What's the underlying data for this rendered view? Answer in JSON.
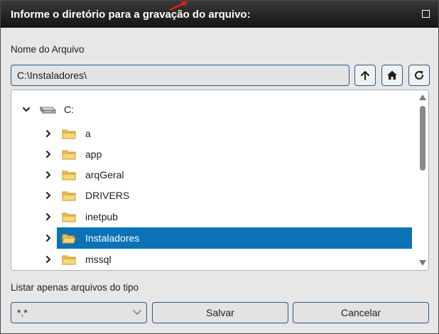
{
  "dialog": {
    "title": "Informe o diretório para a gravação do arquivo:"
  },
  "file_name": {
    "label": "Nome do Arquivo",
    "value": "C:\\Instaladores\\"
  },
  "toolbar": {
    "up_icon": "arrow-up-icon",
    "home_icon": "home-icon",
    "refresh_icon": "refresh-icon"
  },
  "tree": {
    "root": {
      "label": "C:",
      "icon": "drive-icon",
      "expanded": true
    },
    "items": [
      {
        "label": "a",
        "icon": "folder-icon",
        "selected": false
      },
      {
        "label": "app",
        "icon": "folder-icon",
        "selected": false
      },
      {
        "label": "arqGeral",
        "icon": "folder-icon",
        "selected": false
      },
      {
        "label": "DRIVERS",
        "icon": "folder-icon",
        "selected": false
      },
      {
        "label": "inetpub",
        "icon": "folder-icon",
        "selected": false
      },
      {
        "label": "Instaladores",
        "icon": "folder-icon",
        "selected": true
      },
      {
        "label": "mssql",
        "icon": "folder-icon",
        "selected": false
      }
    ]
  },
  "filter": {
    "label": "Listar apenas arquivos do tipo",
    "value": "*.*"
  },
  "actions": {
    "save_label": "Salvar",
    "cancel_label": "Cancelar"
  },
  "colors": {
    "accent": "#0b72b5",
    "border": "#2b5a85",
    "titlebar": "#1a1a1a",
    "folder": "#f2c04a"
  }
}
